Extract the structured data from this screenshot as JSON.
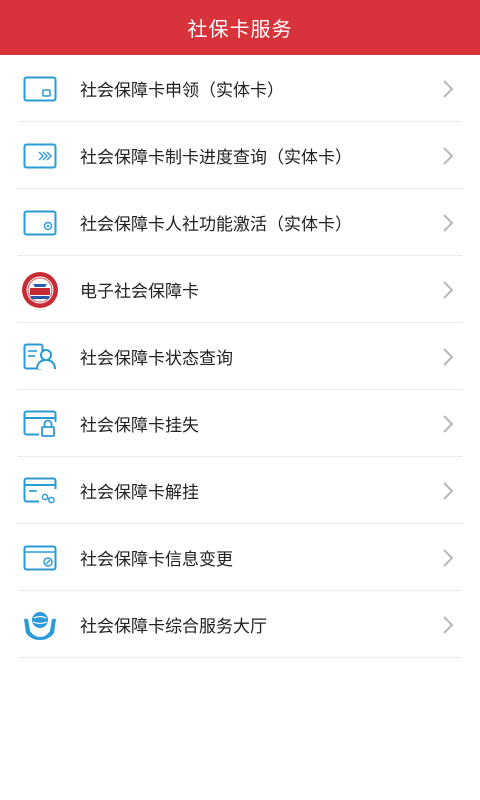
{
  "header": {
    "title": "社保卡服务"
  },
  "colors": {
    "header_bg": "#d8323a",
    "icon_blue": "#2a9bd6",
    "chevron": "#b8b8b8"
  },
  "items": [
    {
      "label": "社会保障卡申领（实体卡）",
      "icon": "card-chip-icon"
    },
    {
      "label": "社会保障卡制卡进度查询（实体卡）",
      "icon": "card-progress-icon"
    },
    {
      "label": "社会保障卡人社功能激活（实体卡）",
      "icon": "card-activate-icon"
    },
    {
      "label": "电子社会保障卡",
      "icon": "social-security-seal-icon"
    },
    {
      "label": "社会保障卡状态查询",
      "icon": "status-query-icon"
    },
    {
      "label": "社会保障卡挂失",
      "icon": "card-lock-icon"
    },
    {
      "label": "社会保障卡解挂",
      "icon": "card-unlock-icon"
    },
    {
      "label": "社会保障卡信息变更",
      "icon": "card-edit-icon"
    },
    {
      "label": "社会保障卡综合服务大厅",
      "icon": "service-hall-icon"
    }
  ]
}
